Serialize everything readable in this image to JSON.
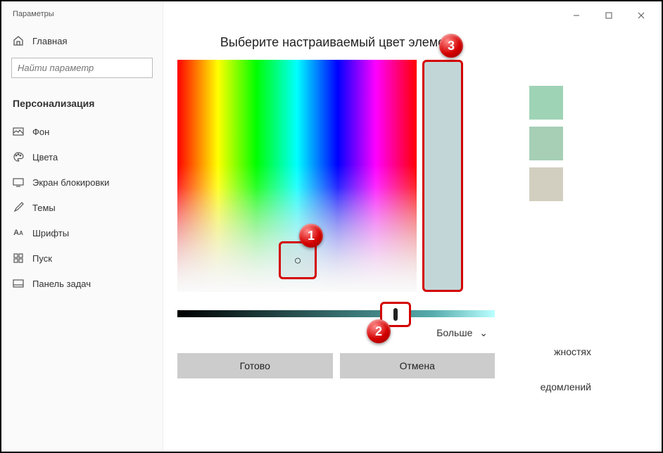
{
  "window": {
    "title": "Параметры"
  },
  "sidebar": {
    "home": "Главная",
    "search_placeholder": "Найти параметр",
    "section": "Персонализация",
    "items": [
      {
        "label": "Фон"
      },
      {
        "label": "Цвета"
      },
      {
        "label": "Экран блокировки"
      },
      {
        "label": "Темы"
      },
      {
        "label": "Шрифты"
      },
      {
        "label": "Пуск"
      },
      {
        "label": "Панель задач"
      }
    ]
  },
  "dialog": {
    "title": "Выберите настраиваемый цвет элемен",
    "more": "Больше",
    "ok": "Готово",
    "cancel": "Отмена",
    "preview_hex": "#c3d6d7"
  },
  "background_fragments": {
    "line1": "жностях",
    "line2": "едомлений"
  },
  "swatches": [
    "#9fd3b6",
    "#a6cfb6",
    "#d3cfc0"
  ],
  "annotations": {
    "n1": "1",
    "n2": "2",
    "n3": "3"
  }
}
